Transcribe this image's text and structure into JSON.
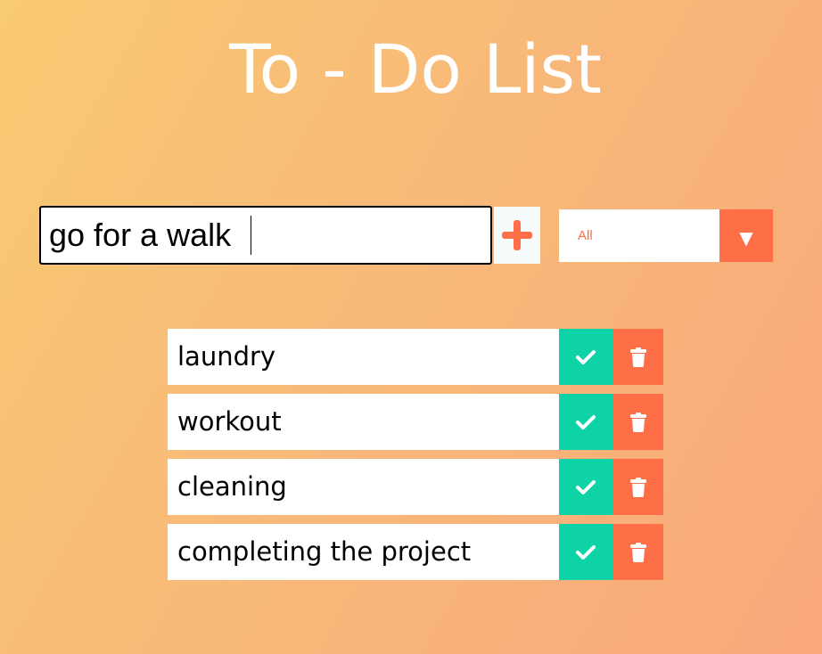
{
  "header": {
    "title": "To - Do List"
  },
  "form": {
    "task_input_value": "go for a walk",
    "add_icon": "plus-icon",
    "filter": {
      "selected": "All",
      "arrow": "▼"
    }
  },
  "todos": [
    {
      "text": "laundry"
    },
    {
      "text": "workout"
    },
    {
      "text": "cleaning"
    },
    {
      "text": "completing the project"
    }
  ],
  "icons": {
    "complete": "check-icon",
    "delete": "trash-icon"
  },
  "colors": {
    "accent": "#ff6f47",
    "complete": "#0ed3a7",
    "background_start": "#f8ca72",
    "background_end": "#f9a87a"
  }
}
